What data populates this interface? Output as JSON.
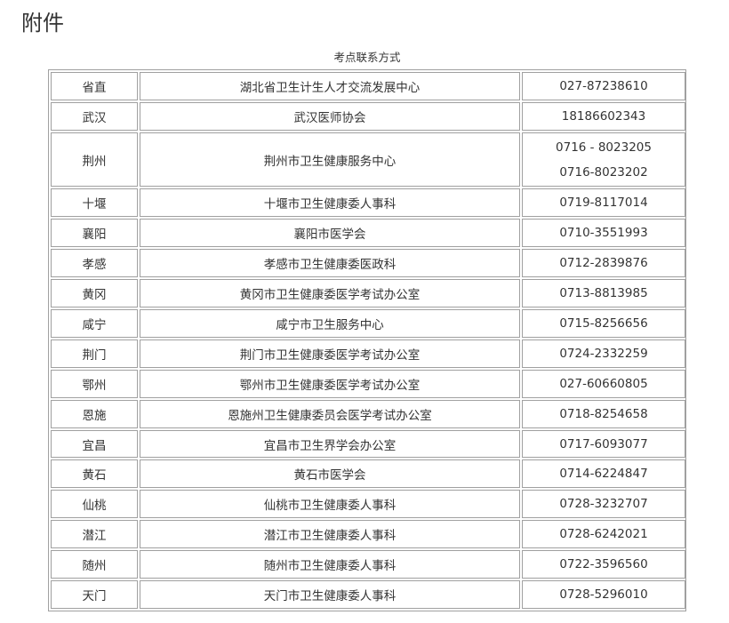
{
  "heading": "附件",
  "caption": "考点联系方式",
  "rows": [
    {
      "city": "省直",
      "org": "湖北省卫生计生人才交流发展中心",
      "phones": [
        "027-87238610"
      ]
    },
    {
      "city": "武汉",
      "org": "武汉医师协会",
      "phones": [
        "18186602343"
      ]
    },
    {
      "city": "荆州",
      "org": "荆州市卫生健康服务中心",
      "phones": [
        "0716 - 8023205",
        "0716-8023202"
      ]
    },
    {
      "city": "十堰",
      "org": "十堰市卫生健康委人事科",
      "phones": [
        "0719-8117014"
      ]
    },
    {
      "city": "襄阳",
      "org": "襄阳市医学会",
      "phones": [
        "0710-3551993"
      ]
    },
    {
      "city": "孝感",
      "org": "孝感市卫生健康委医政科",
      "phones": [
        "0712-2839876"
      ]
    },
    {
      "city": "黄冈",
      "org": "黄冈市卫生健康委医学考试办公室",
      "phones": [
        "0713-8813985"
      ]
    },
    {
      "city": "咸宁",
      "org": "咸宁市卫生服务中心",
      "phones": [
        "0715-8256656"
      ]
    },
    {
      "city": "荆门",
      "org": "荆门市卫生健康委医学考试办公室",
      "phones": [
        "0724-2332259"
      ]
    },
    {
      "city": "鄂州",
      "org": "鄂州市卫生健康委医学考试办公室",
      "phones": [
        "027-60660805"
      ]
    },
    {
      "city": "恩施",
      "org": "恩施州卫生健康委员会医学考试办公室",
      "phones": [
        "0718-8254658"
      ]
    },
    {
      "city": "宜昌",
      "org": "宜昌市卫生界学会办公室",
      "phones": [
        "0717-6093077"
      ]
    },
    {
      "city": "黄石",
      "org": "黄石市医学会",
      "phones": [
        "0714-6224847"
      ]
    },
    {
      "city": "仙桃",
      "org": "仙桃市卫生健康委人事科",
      "phones": [
        "0728-3232707"
      ]
    },
    {
      "city": "潜江",
      "org": "潜江市卫生健康委人事科",
      "phones": [
        "0728-6242021"
      ]
    },
    {
      "city": "随州",
      "org": "随州市卫生健康委人事科",
      "phones": [
        "0722-3596560"
      ]
    },
    {
      "city": "天门",
      "org": "天门市卫生健康委人事科",
      "phones": [
        "0728-5296010"
      ]
    }
  ]
}
